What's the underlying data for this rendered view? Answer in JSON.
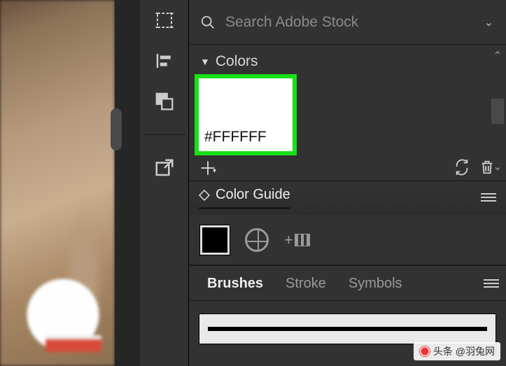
{
  "search": {
    "placeholder": "Search Adobe Stock"
  },
  "colors": {
    "header": "Colors",
    "swatch_hex": "#FFFFFF",
    "swatch_value": "#FFFFFF"
  },
  "colorGuide": {
    "title": "Color Guide",
    "base_swatch": "#000000"
  },
  "brushTabs": {
    "tabs": [
      "Brushes",
      "Stroke",
      "Symbols"
    ],
    "active": "Brushes"
  },
  "watermark": "头条 @羽兔网",
  "icons": {
    "chevron_down": "⌄",
    "chevron_up": "⌃",
    "triangle": "▼",
    "plus": "＋"
  }
}
